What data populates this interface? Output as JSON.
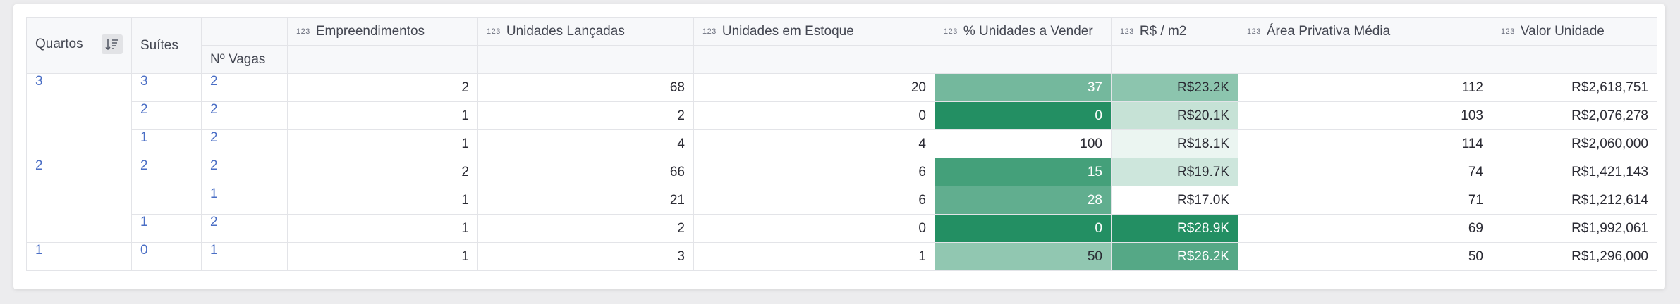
{
  "headers": {
    "quartos": "Quartos",
    "suites": "Suítes",
    "vagas": "Nº Vagas",
    "type_tag": "123",
    "columns": [
      "Empreendimentos",
      "Unidades Lançadas",
      "Unidades em Estoque",
      "% Unidades a Vender",
      "R$ / m2",
      "Área Privativa Média",
      "Valor Unidade"
    ]
  },
  "colors": {
    "pct_scale": [
      "#ffffff",
      "#238f63"
    ],
    "m2_scale": [
      "#ffffff",
      "#238f63"
    ],
    "row_header_text": "#4a6ec5"
  },
  "rows": [
    {
      "quartos": "3",
      "suites": "3",
      "vagas": "2",
      "empreendimentos": "2",
      "lancadas": "68",
      "estoque": "20",
      "pct": "37",
      "pct_val": 37,
      "m2": "R$23.2K",
      "m2_val": 23.2,
      "area": "112",
      "valor": "R$2,618,751"
    },
    {
      "quartos": "",
      "suites": "2",
      "vagas": "2",
      "empreendimentos": "1",
      "lancadas": "2",
      "estoque": "0",
      "pct": "0",
      "pct_val": 0,
      "m2": "R$20.1K",
      "m2_val": 20.1,
      "area": "103",
      "valor": "R$2,076,278"
    },
    {
      "quartos": "",
      "suites": "1",
      "vagas": "2",
      "empreendimentos": "1",
      "lancadas": "4",
      "estoque": "4",
      "pct": "100",
      "pct_val": 100,
      "m2": "R$18.1K",
      "m2_val": 18.1,
      "area": "114",
      "valor": "R$2,060,000"
    },
    {
      "quartos": "2",
      "suites": "2",
      "vagas": "2",
      "empreendimentos": "2",
      "lancadas": "66",
      "estoque": "6",
      "pct": "15",
      "pct_val": 15,
      "m2": "R$19.7K",
      "m2_val": 19.7,
      "area": "74",
      "valor": "R$1,421,143"
    },
    {
      "quartos": "",
      "suites": "",
      "vagas": "1",
      "empreendimentos": "1",
      "lancadas": "21",
      "estoque": "6",
      "pct": "28",
      "pct_val": 28,
      "m2": "R$17.0K",
      "m2_val": 17.0,
      "area": "71",
      "valor": "R$1,212,614"
    },
    {
      "quartos": "",
      "suites": "1",
      "vagas": "2",
      "empreendimentos": "1",
      "lancadas": "2",
      "estoque": "0",
      "pct": "0",
      "pct_val": 0,
      "m2": "R$28.9K",
      "m2_val": 28.9,
      "area": "69",
      "valor": "R$1,992,061"
    },
    {
      "quartos": "1",
      "suites": "0",
      "vagas": "1",
      "empreendimentos": "1",
      "lancadas": "3",
      "estoque": "1",
      "pct": "50",
      "pct_val": 50,
      "m2": "R$26.2K",
      "m2_val": 26.2,
      "area": "50",
      "valor": "R$1,296,000"
    }
  ]
}
